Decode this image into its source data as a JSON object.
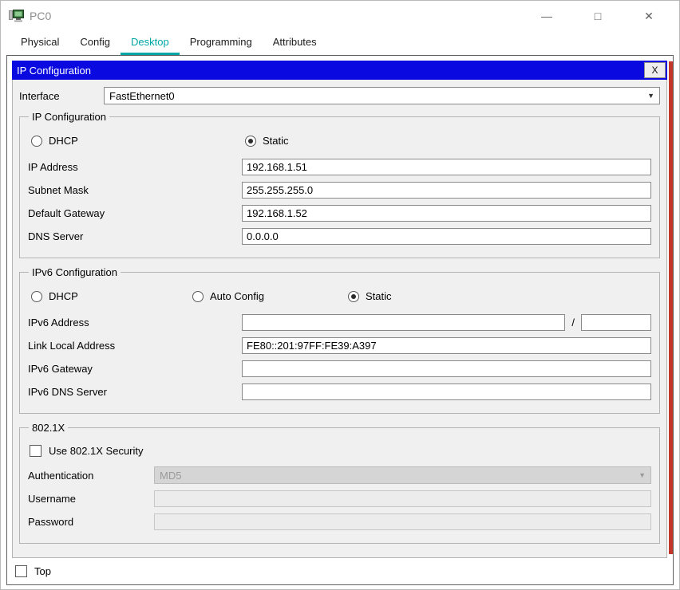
{
  "window": {
    "title": "PC0",
    "controls": {
      "minimize": "—",
      "maximize": "□",
      "close": "✕"
    }
  },
  "tabs": {
    "items": [
      {
        "label": "Physical"
      },
      {
        "label": "Config"
      },
      {
        "label": "Desktop"
      },
      {
        "label": "Programming"
      },
      {
        "label": "Attributes"
      }
    ]
  },
  "dialog": {
    "title": "IP Configuration",
    "close_label": "X",
    "interface_row": {
      "label": "Interface",
      "value": "FastEthernet0"
    },
    "ipv4": {
      "group_title": "IP Configuration",
      "radio_dhcp": "DHCP",
      "radio_static": "Static",
      "fields": [
        {
          "label": "IP Address",
          "value": "192.168.1.51"
        },
        {
          "label": "Subnet Mask",
          "value": "255.255.255.0"
        },
        {
          "label": "Default Gateway",
          "value": "192.168.1.52"
        },
        {
          "label": "DNS Server",
          "value": "0.0.0.0"
        }
      ]
    },
    "ipv6": {
      "group_title": "IPv6 Configuration",
      "radio_dhcp": "DHCP",
      "radio_auto": "Auto Config",
      "radio_static": "Static",
      "address": {
        "label": "IPv6 Address",
        "value": "",
        "separator": "/",
        "prefix_value": ""
      },
      "fields": [
        {
          "label": "Link Local Address",
          "value": "FE80::201:97FF:FE39:A397"
        },
        {
          "label": "IPv6 Gateway",
          "value": ""
        },
        {
          "label": "IPv6 DNS Server",
          "value": ""
        }
      ]
    },
    "dot1x": {
      "group_title": "802.1X",
      "checkbox_label": "Use 802.1X Security",
      "authentication": {
        "label": "Authentication",
        "value": "MD5"
      },
      "username": {
        "label": "Username",
        "value": ""
      },
      "password": {
        "label": "Password",
        "value": ""
      }
    }
  },
  "footer": {
    "checkbox_label": "Top"
  },
  "colors": {
    "dialog_header": "#0a0ae0",
    "active_tab": "#00a6a6",
    "edge_accent": "#c3372a"
  }
}
